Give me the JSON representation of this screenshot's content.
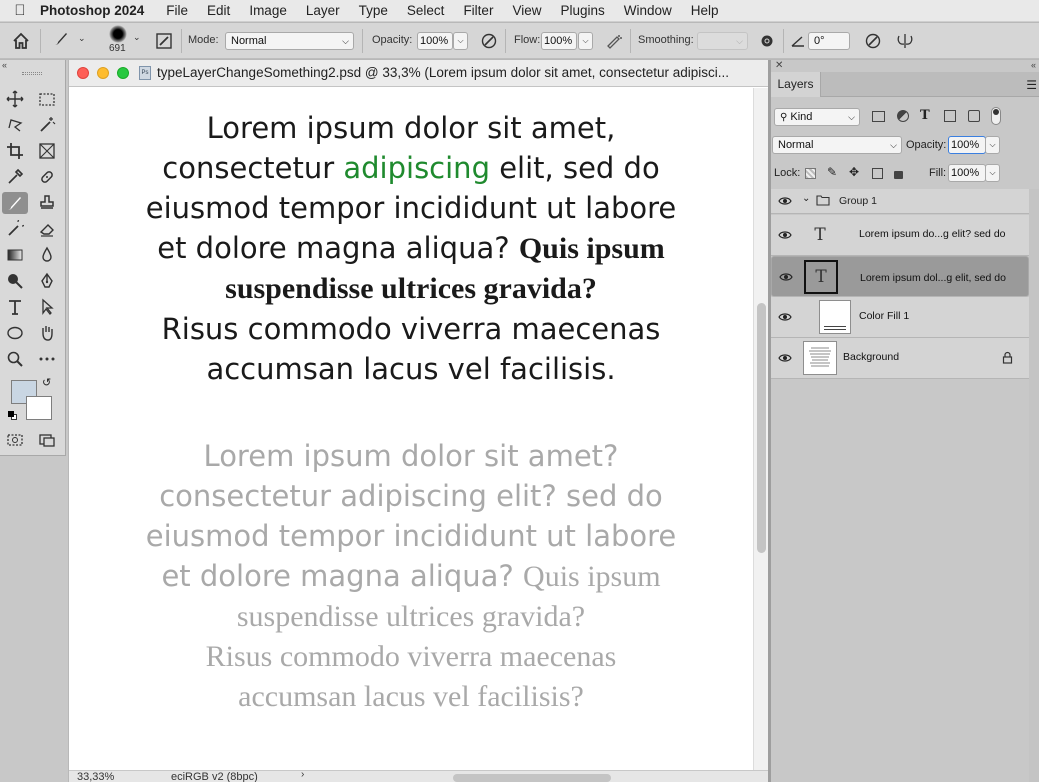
{
  "menubar": {
    "app_name": "Photoshop 2024",
    "items": [
      "File",
      "Edit",
      "Image",
      "Layer",
      "Type",
      "Select",
      "Filter",
      "View",
      "Plugins",
      "Window",
      "Help"
    ]
  },
  "options_bar": {
    "brush_size": "691",
    "mode_label": "Mode:",
    "mode_value": "Normal",
    "opacity_label": "Opacity:",
    "opacity_value": "100%",
    "flow_label": "Flow:",
    "flow_value": "100%",
    "smoothing_label": "Smoothing:",
    "smoothing_value": "",
    "angle_value": "0°"
  },
  "document": {
    "title": "typeLayerChangeSomething2.psd @ 33,3% (Lorem ipsum dolor sit amet, consectetur adipisci...",
    "text_block_1": {
      "l1": "Lorem ipsum dolor sit amet,",
      "l2a": "consectetur ",
      "l2b": "adipiscing",
      "l2c": " elit, sed do",
      "l3": "eiusmod tempor incididunt ut labore",
      "l4a": "et dolore magna aliqua? ",
      "l4b": "Quis ipsum",
      "l5": "suspendisse ultrices gravida?",
      "l6": "Risus commodo viverra maecenas",
      "l7": "accumsan lacus vel facilisis."
    },
    "text_block_2": {
      "l1": "Lorem ipsum dolor sit amet?",
      "l2": "consectetur adipiscing elit? sed do",
      "l3": "eiusmod tempor incididunt ut labore",
      "l4a": "et dolore magna aliqua? ",
      "l4b": "Quis ipsum",
      "l5": "suspendisse ultrices gravida?",
      "l6": "Risus commodo viverra maecenas",
      "l7": "accumsan lacus vel facilisis?"
    },
    "status": {
      "zoom": "33,33%",
      "profile": "eciRGB v2 (8bpc)"
    }
  },
  "layers_panel": {
    "tab": "Layers",
    "filter_kind": "Kind",
    "blend_mode": "Normal",
    "opacity_label": "Opacity:",
    "opacity_value": "100%",
    "lock_label": "Lock:",
    "fill_label": "Fill:",
    "fill_value": "100%",
    "group_name": "Group 1",
    "layers": [
      {
        "name": "Lorem ipsum do...g elit? sed do"
      },
      {
        "name": "Lorem ipsum dol...g elit, sed do"
      },
      {
        "name": "Color Fill 1"
      },
      {
        "name": "Background"
      }
    ]
  },
  "colors": {
    "accent_green": "#1f8a2e",
    "foreground_swatch": "#c9d6e3",
    "background_swatch": "#ffffff",
    "selected_layer": "#9a9a9a"
  }
}
